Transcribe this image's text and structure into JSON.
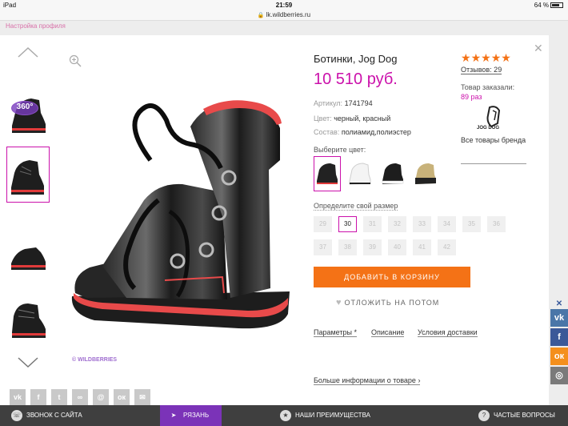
{
  "status_bar": {
    "device": "iPad",
    "time": "21:59",
    "battery": "64 %"
  },
  "address_bar": {
    "url": "lk.wildberries.ru"
  },
  "background_page": {
    "breadcrumb": "Настройка профиля"
  },
  "product": {
    "title": "Ботинки, Jog Dog",
    "price": "10 510 руб.",
    "article_label": "Артикул:",
    "article_value": "1741794",
    "color_label": "Цвет:",
    "color_value": "черный, красный",
    "composition_label": "Состав:",
    "composition_value": "полиамид,полиэстер",
    "watermark": "© WILDBERRIES"
  },
  "color_picker": {
    "label": "Выберите цвет:",
    "swatches": [
      {
        "name": "black-red",
        "color": "#222222",
        "accent": "#e03a3a",
        "selected": true
      },
      {
        "name": "white",
        "color": "#f4f4f4",
        "accent": "#cfcfcf",
        "selected": false
      },
      {
        "name": "black-white",
        "color": "#1d1d1d",
        "accent": "#ffffff",
        "selected": false
      },
      {
        "name": "gold-black",
        "color": "#c8b27a",
        "accent": "#222222",
        "selected": false
      }
    ]
  },
  "size_picker": {
    "label": "Определите свой размер",
    "sizes": [
      "29",
      "30",
      "31",
      "32",
      "33",
      "34",
      "35",
      "36",
      "37",
      "38",
      "39",
      "40",
      "41",
      "42"
    ],
    "selected": "30"
  },
  "actions": {
    "add_to_cart": "ДОБАВИТЬ В КОРЗИНУ",
    "postpone": "ОТЛОЖИТЬ НА ПОТОМ"
  },
  "tabs": [
    "Параметры *",
    "Описание",
    "Условия доставки"
  ],
  "more_info": "Больше информации о товаре",
  "rating": {
    "stars": 5,
    "reviews": "Отзывов: 29",
    "ordered_label": "Товар заказали:",
    "ordered_value": "89 раз"
  },
  "brand": {
    "name": "JOG DOG",
    "all_link": "Все товары бренда"
  },
  "badge360": "360°",
  "social_share": [
    "vk-icon",
    "facebook-icon",
    "twitter-icon",
    "link-icon",
    "mail-icon",
    "odnoklassniki-icon",
    "email-icon"
  ],
  "right_social": [
    "vk-icon",
    "facebook-icon",
    "odnoklassniki-icon",
    "instagram-icon"
  ],
  "bottom_bar": {
    "call": "ЗВОНОК С САЙТА",
    "city": "РЯЗАНЬ",
    "advantages": "НАШИ ПРЕИМУЩЕСТВА",
    "faq": "ЧАСТЫЕ ВОПРОСЫ"
  },
  "colors": {
    "brand_pink": "#cb11ab",
    "cart_orange": "#f47216",
    "city_purple": "#7b33b8"
  }
}
